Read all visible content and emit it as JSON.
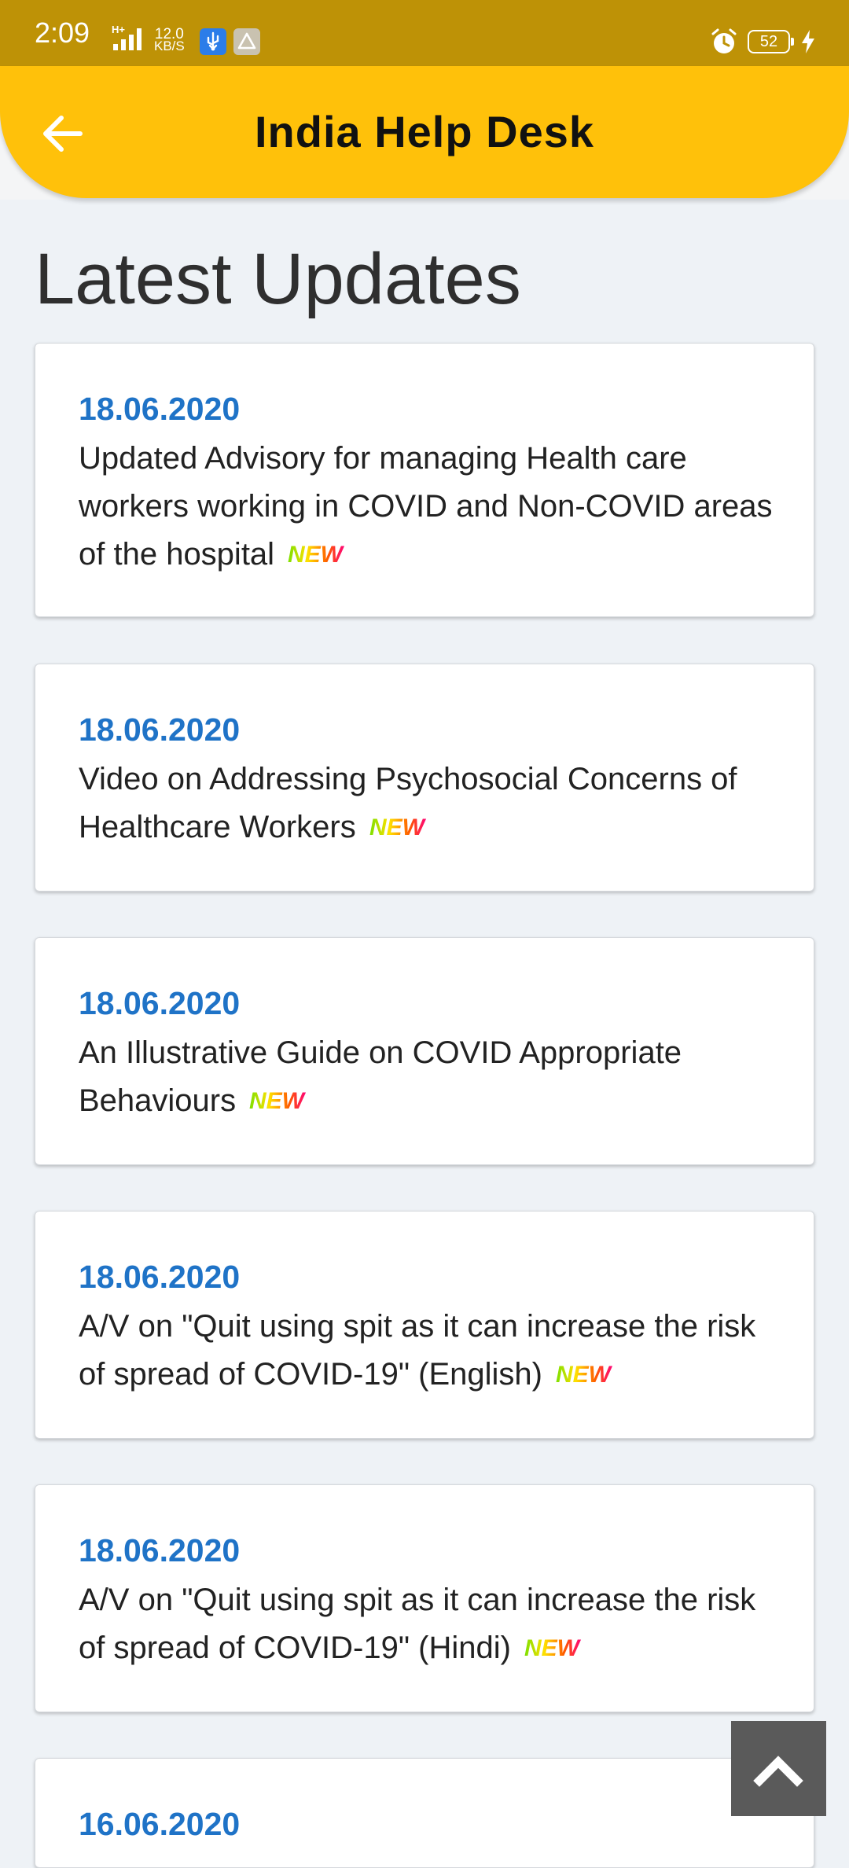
{
  "status_bar": {
    "time": "2:09",
    "network": "H+",
    "speed_value": "12.0",
    "speed_unit": "KB/S",
    "battery": "52"
  },
  "header": {
    "title": "India Help Desk",
    "back_icon": "arrow-left-icon",
    "background_color": "#ffc10a"
  },
  "page": {
    "title": "Latest Updates"
  },
  "updates": [
    {
      "date": "18.06.2020",
      "text": "Updated Advisory for managing Health care workers working in COVID and Non-COVID areas of the hospital",
      "badge": "NEW"
    },
    {
      "date": "18.06.2020",
      "text": "Video on Addressing Psychosocial Concerns of Healthcare Workers",
      "badge": "NEW"
    },
    {
      "date": "18.06.2020",
      "text": "An Illustrative Guide on COVID Appropriate Behaviours",
      "badge": "NEW"
    },
    {
      "date": "18.06.2020",
      "text": "A/V on \"Quit using spit as it can increase the risk of spread of COVID-19\" (English)",
      "badge": "NEW"
    },
    {
      "date": "18.06.2020",
      "text": "A/V on \"Quit using spit as it can increase the risk of spread of COVID-19\" (Hindi)",
      "badge": "NEW"
    },
    {
      "date": "16.06.2020",
      "text": "",
      "badge": ""
    }
  ],
  "scroll_top": {
    "icon": "chevron-up-icon"
  },
  "colors": {
    "date": "#1f73c7",
    "status_bar": "#be9206"
  }
}
